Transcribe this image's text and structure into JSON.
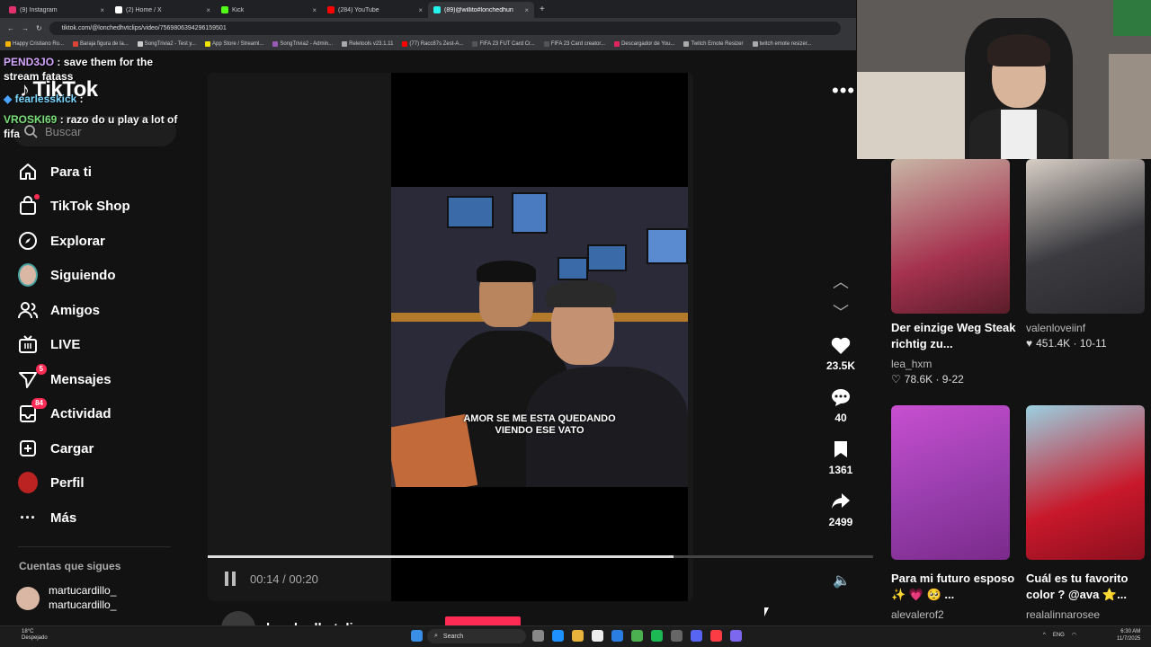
{
  "browser": {
    "tabs": [
      {
        "label": "(9) Instagram",
        "color": "#e1306c"
      },
      {
        "label": "(2) Home / X",
        "color": "#ffffff"
      },
      {
        "label": "Kick",
        "color": "#53fc18"
      },
      {
        "label": "(284) YouTube",
        "color": "#ff0000"
      },
      {
        "label": "(89)@willito#lonchedhun",
        "color": "#25f4ee"
      }
    ],
    "url": "tiktok.com/@lonchedhvtclips/video/7569806394296159501",
    "bookmarks": [
      "Happy Cristiano Ro...",
      "Baraja figura de la...",
      "SongTrivia2 - Test y...",
      "App Store / Streaml...",
      "SongTrivia2 - Admin...",
      "Reletools v23.1.11",
      "(77) Racc87s Zest-A...",
      "FIFA 23 FUT Card Cr...",
      "FIFA 23 Card creator...",
      "Descargador de You...",
      "Twitch Emote Resizer",
      "twitch emote resizer..."
    ]
  },
  "chat": [
    {
      "user": "PEND3JO",
      "text": " : save them for the stream fatass"
    },
    {
      "user": "fearlesskick",
      "text": " :"
    },
    {
      "user": "VROSKI69",
      "text": " : razo do u play a lot of fifa"
    }
  ],
  "sidebar": {
    "logo": "TikTok",
    "search_placeholder": "Buscar",
    "items": [
      {
        "label": "Para ti",
        "icon": "home-icon"
      },
      {
        "label": "TikTok Shop",
        "icon": "shop-icon"
      },
      {
        "label": "Explorar",
        "icon": "compass-icon"
      },
      {
        "label": "Siguiendo",
        "icon": "avatar-icon"
      },
      {
        "label": "Amigos",
        "icon": "friends-icon"
      },
      {
        "label": "LIVE",
        "icon": "live-icon"
      },
      {
        "label": "Mensajes",
        "icon": "send-icon",
        "badge": "5"
      },
      {
        "label": "Actividad",
        "icon": "inbox-icon",
        "badge": "84"
      },
      {
        "label": "Cargar",
        "icon": "plus-square-icon"
      },
      {
        "label": "Perfil",
        "icon": "profile-icon"
      },
      {
        "label": "Más",
        "icon": "more-icon"
      }
    ],
    "following_title": "Cuentas que sigues",
    "following": [
      {
        "name": "martucardillo_",
        "handle": "martucardillo_"
      }
    ]
  },
  "video": {
    "caption_line1": "AMOR SE ME ESTA QUEDANDO",
    "caption_line2": "VIENDO ESE VATO",
    "time": "00:14 / 00:20",
    "progress": 0.7,
    "author": "lonchedhvtclips",
    "likes": "23.5K",
    "comments": "40",
    "saves": "1361",
    "shares": "2499"
  },
  "related": [
    {
      "title": "Der einzige Weg Steak richtig zu...",
      "user": "lea_hxm",
      "stat": "78.6K · 9-22",
      "color": "#a5324f"
    },
    {
      "title": "",
      "user": "valenloveiinf",
      "stat": "451.4K · 10-11",
      "color": "#3b3b40"
    },
    {
      "title": "Para mi futuro esposo ✨ 💗 🥺 ...",
      "user": "alevalerof2",
      "stat": "",
      "color": "#9b3fb0"
    },
    {
      "title": "Cuál es tu favorito color ? @ava ⭐...",
      "user": "realalinnarosee",
      "stat": "",
      "color": "#c8182a"
    }
  ],
  "taskbar": {
    "temp": "18°C",
    "weather": "Despejado",
    "search": "Search",
    "lang": "ENG",
    "time": "6:30 AM",
    "date": "11/7/2025"
  }
}
